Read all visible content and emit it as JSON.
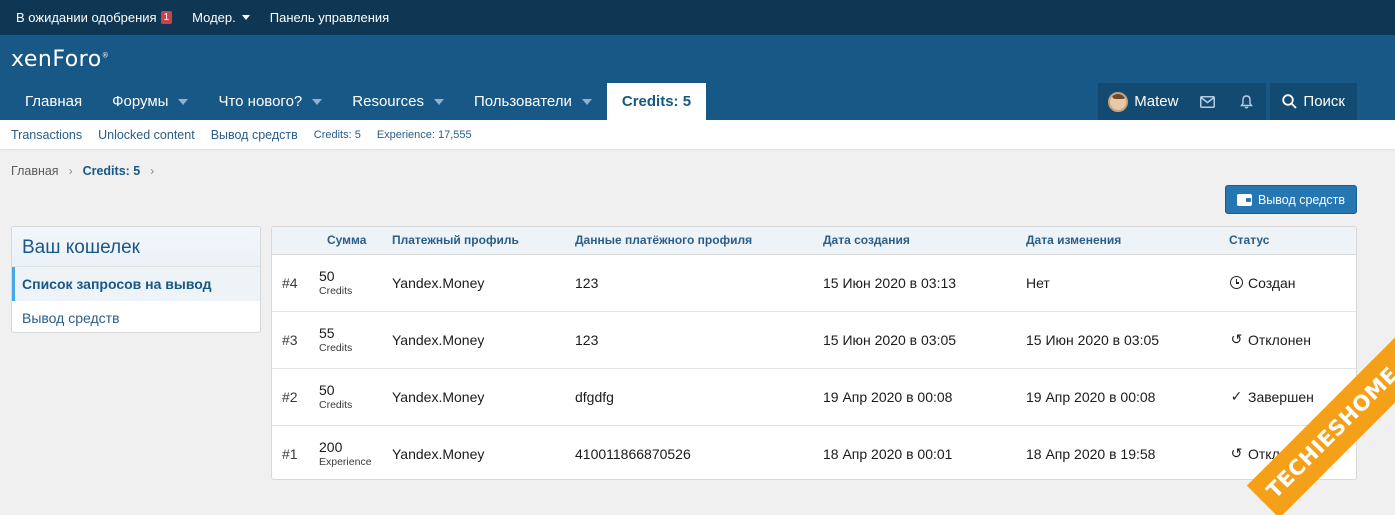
{
  "staffbar": {
    "approval_label": "В ожидании одобрения",
    "approval_count": "1",
    "moder_label": "Модер.",
    "admin_label": "Панель управления"
  },
  "header": {
    "logo_text": "xenForo",
    "logo_mark": "®"
  },
  "nav": {
    "tabs": [
      {
        "label": "Главная"
      },
      {
        "label": "Форумы"
      },
      {
        "label": "Что нового?"
      },
      {
        "label": "Resources"
      },
      {
        "label": "Пользователи"
      },
      {
        "label": "Credits: 5"
      }
    ],
    "user_name": "Matew",
    "search_label": "Поиск"
  },
  "subnav": {
    "links": [
      "Transactions",
      "Unlocked content",
      "Вывод средств"
    ],
    "stats": [
      "Credits: 5",
      "Experience: 17,555"
    ]
  },
  "breadcrumb": {
    "home": "Главная",
    "current": "Credits: 5"
  },
  "withdraw_button_label": "Вывод средств",
  "sidebar": {
    "title": "Ваш кошелек",
    "items": [
      {
        "label": "Список запросов на вывод"
      },
      {
        "label": "Вывод средств"
      }
    ]
  },
  "table": {
    "headers": {
      "sum": "Сумма",
      "profile": "Платежный профиль",
      "profile_data": "Данные платёжного профиля",
      "created": "Дата создания",
      "changed": "Дата изменения",
      "status": "Статус"
    },
    "rows": [
      {
        "id": "#4",
        "amount": "50",
        "unit": "Credits",
        "profile": "Yandex.Money",
        "data": "123",
        "created": "15 Июн 2020 в 03:13",
        "changed": "Нет",
        "status": "Создан",
        "status_icon": "clock-icon"
      },
      {
        "id": "#3",
        "amount": "55",
        "unit": "Credits",
        "profile": "Yandex.Money",
        "data": "123",
        "created": "15 Июн 2020 в 03:05",
        "changed": "15 Июн 2020 в 03:05",
        "status": "Отклонен",
        "status_icon": "undo-icon"
      },
      {
        "id": "#2",
        "amount": "50",
        "unit": "Credits",
        "profile": "Yandex.Money",
        "data": "dfgdfg",
        "created": "19 Апр 2020 в 00:08",
        "changed": "19 Апр 2020 в 00:08",
        "status": "Завершен",
        "status_icon": "check-icon"
      },
      {
        "id": "#1",
        "amount": "200",
        "unit": "Experience",
        "profile": "Yandex.Money",
        "data": "410011866870526",
        "created": "18 Апр 2020 в 00:01",
        "changed": "18 Апр 2020 в 19:58",
        "status": "Отклонен",
        "status_icon": "undo-icon"
      }
    ]
  },
  "watermark_text": "TECHIESHOME.COM",
  "colors": {
    "staffbar_bg": "#0f3652",
    "header_bg": "#185886",
    "accent": "#2577b1",
    "watermark": "#f5a019"
  }
}
